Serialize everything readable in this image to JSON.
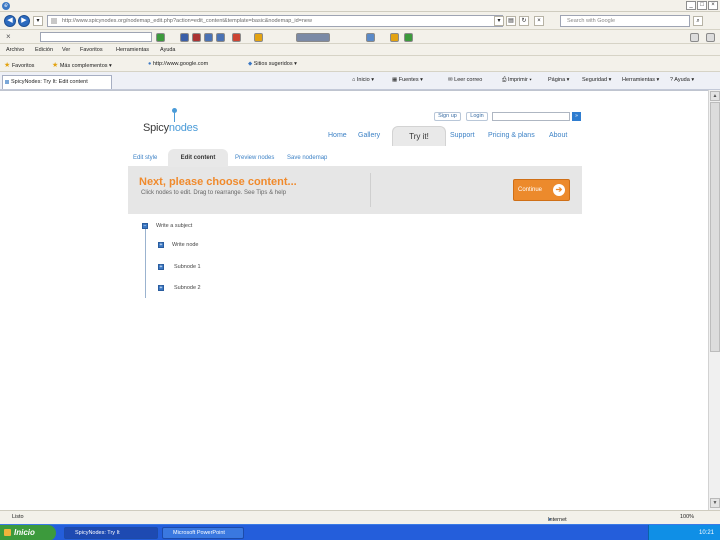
{
  "browser": {
    "url": "http://www.spicynodes.org/nodemap_edit.php?action=edit_content&template=basic&nodemap_id=new",
    "search_placeholder": "Search with Google",
    "menu": [
      "Archivo",
      "Edición",
      "Ver",
      "Favoritos",
      "Herramientas",
      "Ayuda"
    ],
    "favorites": {
      "label": "Favoritos",
      "items": [
        "Más complementos",
        "http://www.google.com",
        "Sitios sugeridos"
      ]
    },
    "tab_title": "SpicyNodes: Try It: Edit content",
    "commands": [
      "Inicio",
      "Fuentes",
      "Leer correo",
      "Imprimir",
      "Página",
      "Seguridad",
      "Herramientas",
      "Ayuda"
    ]
  },
  "site": {
    "logo_text_1": "Spicy",
    "logo_text_2": "nodes",
    "sign_up": "Sign up",
    "login": "Login",
    "login_go": "»",
    "nav": [
      "Home",
      "Gallery",
      "Try it!",
      "Support",
      "Pricing & plans",
      "About"
    ],
    "subnav": [
      "Edit style",
      "Edit content",
      "Preview nodes",
      "Save nodemap"
    ],
    "banner_title": "Next, please choose content...",
    "banner_help": "Click nodes to edit. Drag to rearrange. See Tips & help",
    "continue_label": "Continue",
    "continue_arrow": "➔"
  },
  "tree": {
    "root": "Write a subject",
    "children": [
      "Write node",
      "Subnode 1",
      "Subnode 2"
    ],
    "collapse_symbol": "−",
    "expand_symbol": "+"
  },
  "status": {
    "left": "Listo",
    "zone": "Internet",
    "zoom": "100%"
  },
  "taskbar": {
    "start": "Inicio",
    "items": [
      "SpicyNodes: Try It",
      "Microsoft PowerPoint"
    ],
    "clock": "10:21"
  }
}
